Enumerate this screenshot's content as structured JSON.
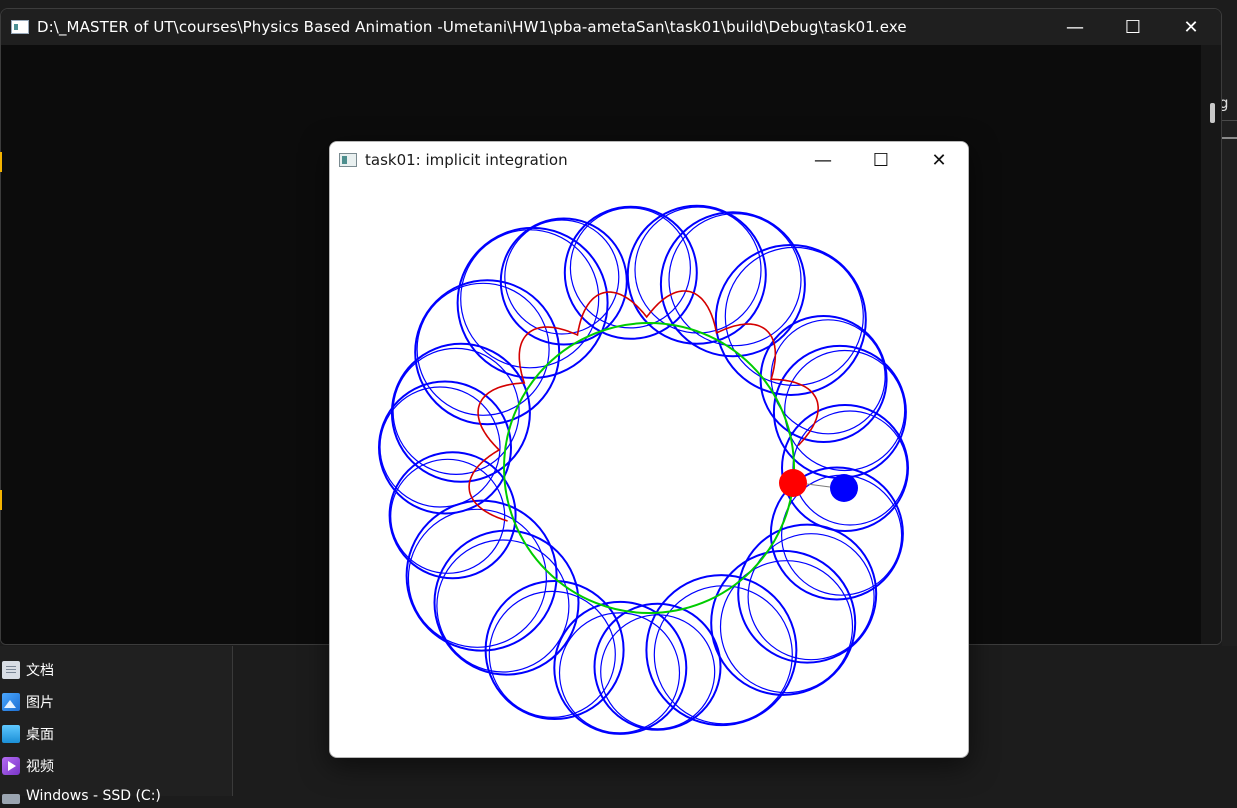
{
  "console": {
    "title": "D:\\_MASTER of UT\\courses\\Physics Based Animation -Umetani\\HW1\\pba-ametaSan\\task01\\build\\Debug\\task01.exe",
    "minimize_glyph": "—",
    "maximize_glyph": "☐",
    "close_glyph": "✕"
  },
  "glut": {
    "title": "task01: implicit integration",
    "minimize_glyph": "—",
    "maximize_glyph": "☐",
    "close_glyph": "✕"
  },
  "simulation": {
    "colors": {
      "orbit": "#0000ff",
      "trajectory": "#d40000",
      "boundary": "#00cc00",
      "explicit_particle": "#ff0000",
      "implicit_particle": "#0000ff"
    }
  },
  "explorer": {
    "sidebar_items": [
      {
        "label": "文档",
        "icon": "document-icon"
      },
      {
        "label": "图片",
        "icon": "pictures-icon"
      },
      {
        "label": "桌面",
        "icon": "desktop-icon"
      },
      {
        "label": "视频",
        "icon": "videos-icon"
      }
    ],
    "clipped_item": "Windows - SSD (C:)",
    "right_strip_text": "g"
  }
}
